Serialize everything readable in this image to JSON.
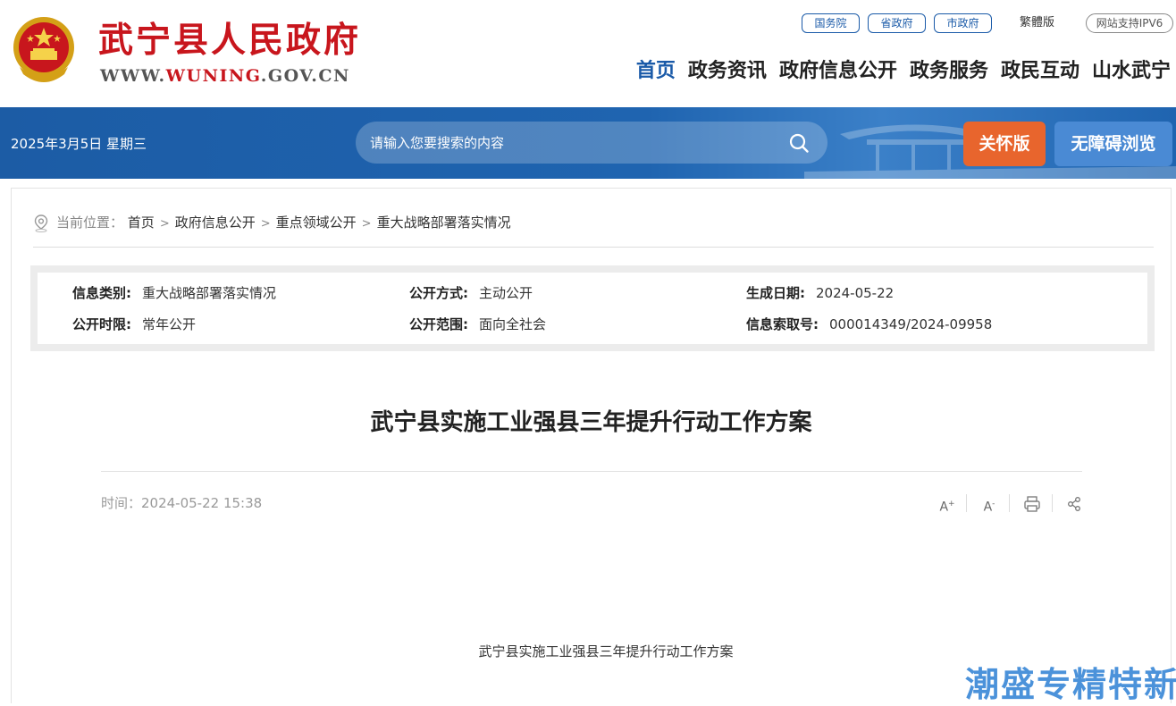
{
  "header": {
    "site_title": "武宁县人民政府",
    "site_domain_prefix": "WWW.",
    "site_domain_main": "WUNING",
    "site_domain_suffix": ".GOV.CN",
    "top_links": {
      "guowuyuan": "国务院",
      "shengzhengfu": "省政府",
      "shizhengfu": "市政府",
      "traditional": "繁體版",
      "ipv6": "网站支持IPV6"
    },
    "nav": [
      "首页",
      "政务资讯",
      "政府信息公开",
      "政务服务",
      "政民互动",
      "山水武宁"
    ]
  },
  "band": {
    "date": "2025年3月5日 星期三",
    "search_placeholder": "请输入您要搜索的内容",
    "care_label": "关怀版",
    "accessible_label": "无障碍浏览"
  },
  "breadcrumb": {
    "label": "当前位置：",
    "items": [
      "首页",
      "政府信息公开",
      "重点领域公开",
      "重大战略部署落实情况"
    ],
    "separator": ">"
  },
  "meta": {
    "category_label": "信息类别:",
    "category_value": "重大战略部署落实情况",
    "method_label": "公开方式:",
    "method_value": "主动公开",
    "date_label": "生成日期:",
    "date_value": "2024-05-22",
    "period_label": "公开时限:",
    "period_value": "常年公开",
    "scope_label": "公开范围:",
    "scope_value": "面向全社会",
    "index_label": "信息索取号:",
    "index_value": "000014349/2024-09958"
  },
  "article": {
    "title": "武宁县实施工业强县三年提升行动工作方案",
    "time": "时间：2024-05-22 15:38",
    "tools": {
      "font_up": "A",
      "font_down": "A",
      "font_up_sign": "+",
      "font_down_sign": "-"
    },
    "body_title": "武宁县实施工业强县三年提升行动工作方案"
  },
  "watermark": "潮盛专精特新",
  "colors": {
    "brand_red": "#c8161d",
    "brand_blue": "#1a5aa8",
    "care_orange": "#e8652d",
    "access_blue": "#4a8ad4"
  }
}
